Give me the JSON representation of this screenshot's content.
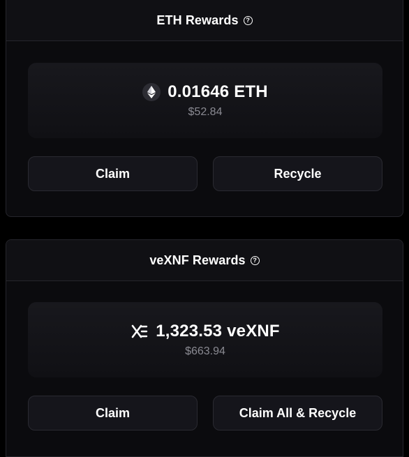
{
  "eth_rewards": {
    "title": "ETH Rewards",
    "help_glyph": "?",
    "amount": "0.01646 ETH",
    "usd_value": "$52.84",
    "token_icon": "ethereum-icon",
    "claim_label": "Claim",
    "recycle_label": "Recycle"
  },
  "vexnf_rewards": {
    "title": "veXNF Rewards",
    "help_glyph": "?",
    "amount": "1,323.53 veXNF",
    "usd_value": "$663.94",
    "token_icon": "xnf-icon",
    "claim_label": "Claim",
    "claim_all_recycle_label": "Claim All & Recycle"
  }
}
